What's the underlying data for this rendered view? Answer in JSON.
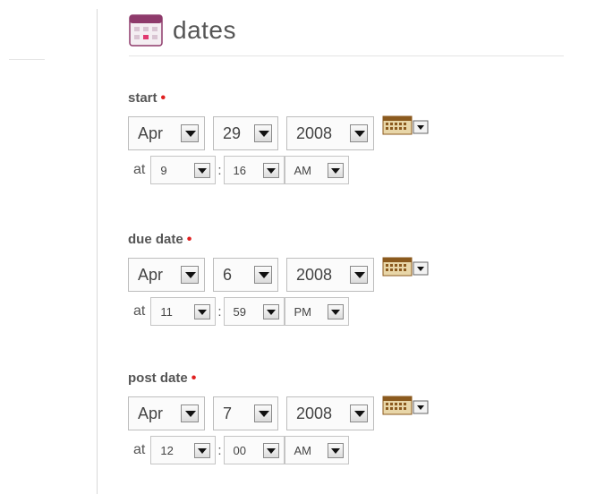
{
  "header": {
    "title": "dates",
    "icon": "calendar-icon"
  },
  "sections": [
    {
      "label": "start",
      "required": "•",
      "month": "Apr",
      "day": "29",
      "year": "2008",
      "at": "at",
      "hour": "9",
      "minute": "16",
      "ampm": "AM"
    },
    {
      "label": "due date",
      "required": "•",
      "month": "Apr",
      "day": "6",
      "year": "2008",
      "at": "at",
      "hour": "11",
      "minute": "59",
      "ampm": "PM"
    },
    {
      "label": "post date",
      "required": "•",
      "month": "Apr",
      "day": "7",
      "year": "2008",
      "at": "at",
      "hour": "12",
      "minute": "00",
      "ampm": "AM"
    }
  ],
  "colors": {
    "required": "#e02020",
    "icon": "#8e3a6b",
    "calendar_button": "#8b5a1e"
  }
}
